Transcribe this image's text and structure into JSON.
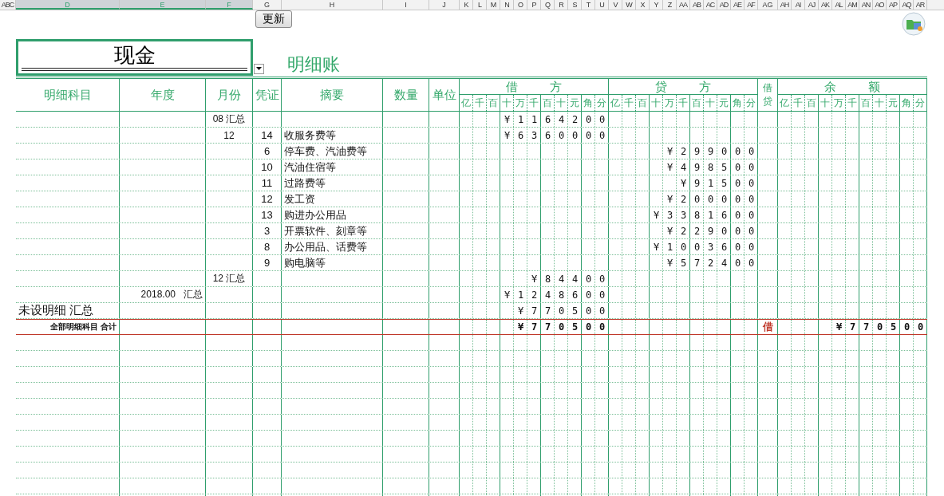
{
  "column_headers": [
    {
      "label": "ABC",
      "selected": false
    },
    {
      "label": "D",
      "selected": true
    },
    {
      "label": "E",
      "selected": true
    },
    {
      "label": "F",
      "selected": true
    },
    {
      "label": "G",
      "selected": false
    },
    {
      "label": "H",
      "selected": false
    },
    {
      "label": "I",
      "selected": false
    },
    {
      "label": "J",
      "selected": false
    },
    {
      "label": "K",
      "selected": false
    },
    {
      "label": "L",
      "selected": false
    },
    {
      "label": "M",
      "selected": false
    },
    {
      "label": "N",
      "selected": false
    },
    {
      "label": "O",
      "selected": false
    },
    {
      "label": "P",
      "selected": false
    },
    {
      "label": "Q",
      "selected": false
    },
    {
      "label": "R",
      "selected": false
    },
    {
      "label": "S",
      "selected": false
    },
    {
      "label": "T",
      "selected": false
    },
    {
      "label": "U",
      "selected": false
    },
    {
      "label": "V",
      "selected": false
    },
    {
      "label": "W",
      "selected": false
    },
    {
      "label": "X",
      "selected": false
    },
    {
      "label": "Y",
      "selected": false
    },
    {
      "label": "Z",
      "selected": false
    },
    {
      "label": "AA",
      "selected": false
    },
    {
      "label": "AB",
      "selected": false
    },
    {
      "label": "AC",
      "selected": false
    },
    {
      "label": "AD",
      "selected": false
    },
    {
      "label": "AE",
      "selected": false
    },
    {
      "label": "AF",
      "selected": false
    },
    {
      "label": "AG",
      "selected": false
    },
    {
      "label": "AH",
      "selected": false
    },
    {
      "label": "AI",
      "selected": false
    },
    {
      "label": "AJ",
      "selected": false
    },
    {
      "label": "AK",
      "selected": false
    },
    {
      "label": "AL",
      "selected": false
    },
    {
      "label": "AM",
      "selected": false
    },
    {
      "label": "AN",
      "selected": false
    },
    {
      "label": "AO",
      "selected": false
    },
    {
      "label": "AP",
      "selected": false
    },
    {
      "label": "AQ",
      "selected": false
    },
    {
      "label": "AR",
      "selected": false
    }
  ],
  "update_button": "更新",
  "account": "现金",
  "title": "明细账",
  "header": {
    "columns": [
      "明细科目",
      "年度",
      "月份",
      "凭证",
      "摘要",
      "数量",
      "单位"
    ],
    "debit": {
      "label": "借 方",
      "units": [
        "亿",
        "千",
        "百",
        "十",
        "万",
        "千",
        "百",
        "十",
        "元",
        "角",
        "分"
      ]
    },
    "credit": {
      "label": "贷 方",
      "units": [
        "亿",
        "千",
        "百",
        "十",
        "万",
        "千",
        "百",
        "十",
        "元",
        "角",
        "分"
      ]
    },
    "direction": "借贷",
    "balance": {
      "label": "余 额",
      "units": [
        "亿",
        "千",
        "百",
        "十",
        "万",
        "千",
        "百",
        "十",
        "元",
        "角",
        "分"
      ]
    }
  },
  "rows": [
    {
      "kind": "entry",
      "month": "08 汇总",
      "debit": "¥1164200"
    },
    {
      "kind": "entry",
      "month": "12",
      "voucher": "14",
      "summary": "收服务费等",
      "debit": "¥6360000"
    },
    {
      "kind": "entry",
      "voucher": "6",
      "summary": "停车费、汽油费等",
      "credit": "¥299000"
    },
    {
      "kind": "entry",
      "voucher": "10",
      "summary": "汽油住宿等",
      "credit": "¥498500"
    },
    {
      "kind": "entry",
      "voucher": "11",
      "summary": "过路费等",
      "credit": "¥91500"
    },
    {
      "kind": "entry",
      "voucher": "12",
      "summary": "发工资",
      "credit": "¥200000"
    },
    {
      "kind": "entry",
      "voucher": "13",
      "summary": "购进办公用品",
      "credit": "¥3381600"
    },
    {
      "kind": "entry",
      "voucher": "3",
      "summary": "开票软件、刻章等",
      "credit": "¥229000"
    },
    {
      "kind": "entry",
      "voucher": "8",
      "summary": "办公用品、话费等",
      "credit": "¥1003600"
    },
    {
      "kind": "entry",
      "voucher": "9",
      "summary": "购电脑等",
      "credit": "¥572400"
    },
    {
      "kind": "entry",
      "month": "12 汇总",
      "debit": "¥84400"
    },
    {
      "kind": "entry",
      "year": "2018.00   汇总",
      "debit": "¥1248600"
    },
    {
      "kind": "entry",
      "subject": "未设明细 汇总",
      "debit": "¥770500"
    },
    {
      "kind": "total",
      "subject": "全部明细科目 合计",
      "debit": "¥770500",
      "direction": "借",
      "balance": "¥770500"
    }
  ]
}
